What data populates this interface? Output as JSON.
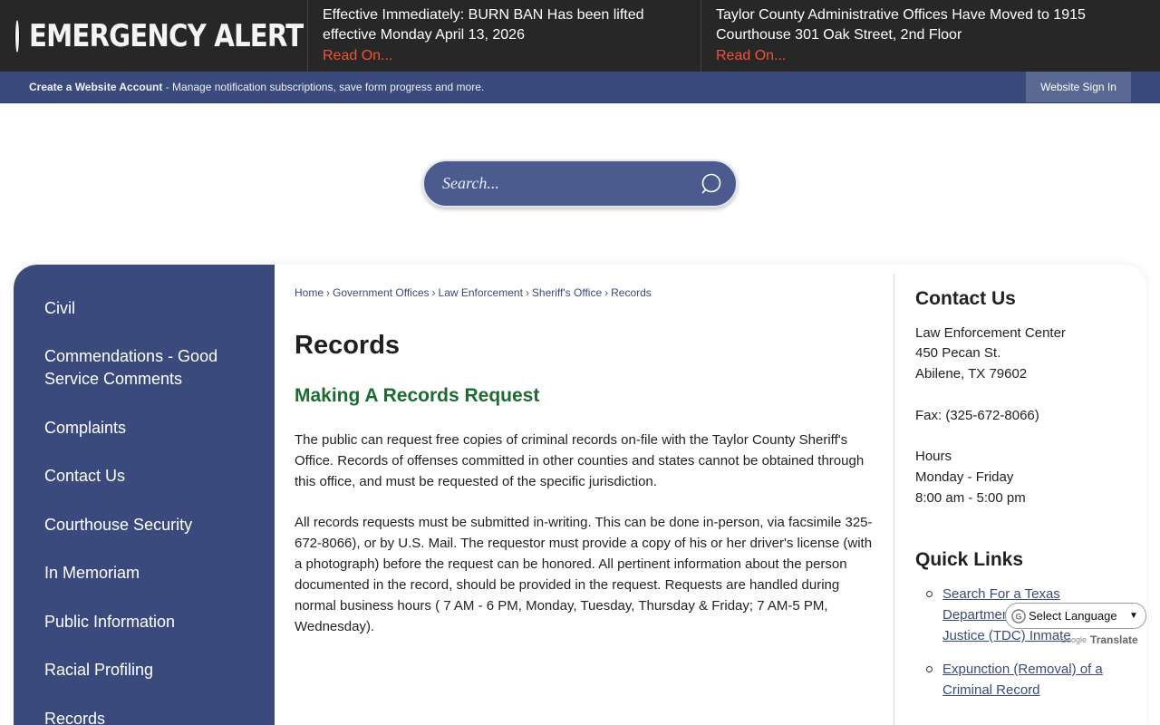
{
  "alert": {
    "title": "EMERGENCY ALERT",
    "items": [
      {
        "text": "Effective Immediately: BURN BAN Has been lifted effective Monday April 13, 2026",
        "link": "Read On..."
      },
      {
        "text": "Taylor County Administrative Offices Have Moved to 1915 Courthouse 301 Oak Street, 2nd Floor",
        "link": "Read On..."
      }
    ]
  },
  "account": {
    "create_label": "Create a Website Account",
    "create_desc": " - Manage notification subscriptions, save form progress and more.",
    "signin_label": "Website Sign In"
  },
  "search": {
    "placeholder": "Search..."
  },
  "sidebar": {
    "items": [
      {
        "label": "Civil"
      },
      {
        "label": "Commendations - Good Service Comments"
      },
      {
        "label": "Complaints"
      },
      {
        "label": "Contact Us"
      },
      {
        "label": "Courthouse Security"
      },
      {
        "label": "In Memoriam"
      },
      {
        "label": "Public Information"
      },
      {
        "label": "Racial Profiling"
      },
      {
        "label": "Records"
      }
    ]
  },
  "breadcrumb": {
    "items": [
      "Home",
      "Government Offices",
      "Law Enforcement",
      "Sheriff's Office",
      "Records"
    ],
    "separator": "›"
  },
  "main": {
    "title": "Records",
    "subtitle": "Making A Records Request",
    "paragraphs": [
      "The public can request free copies of criminal records on-file with the Taylor County Sheriff's Office. Records of offenses committed in other counties and states cannot be obtained through this office, and must be requested of the specific jurisdiction.",
      "All records requests must be submitted in-writing. This can be done in-person, via facsimile 325-672-8066), or by U.S. Mail. The requestor must provide a copy of his or her driver's license (with a photograph) before the request can be honored. All pertinent information about the person documented in the record, should be provided in the request. Requests are handled during normal business hours ( 7 AM - 6 PM, Monday, Tuesday, Thursday & Friday; 7 AM-5 PM, Wednesday)."
    ]
  },
  "contact": {
    "heading": "Contact Us",
    "name": "Law Enforcement Center",
    "street": "450 Pecan St.",
    "city": "Abilene, TX 79602",
    "fax": "Fax: (325-672-8066)",
    "hours_label": "Hours",
    "days": "Monday - Friday",
    "time": "8:00 am - 5:00 pm"
  },
  "quick_links": {
    "heading": "Quick Links",
    "items": [
      {
        "label": "Search For a Texas Department of Criminal Justice (TDC) Inmate"
      },
      {
        "label": "Expunction (Removal) of a Criminal Record"
      }
    ]
  },
  "translate": {
    "select_label": "Select Language",
    "powered_google": "Google",
    "powered_translate": "Translate"
  },
  "colors": {
    "navy": "#3a4a7c",
    "alert_bg": "#272727",
    "read_on": "#f0523a",
    "subtitle_green": "#1d6a33"
  }
}
